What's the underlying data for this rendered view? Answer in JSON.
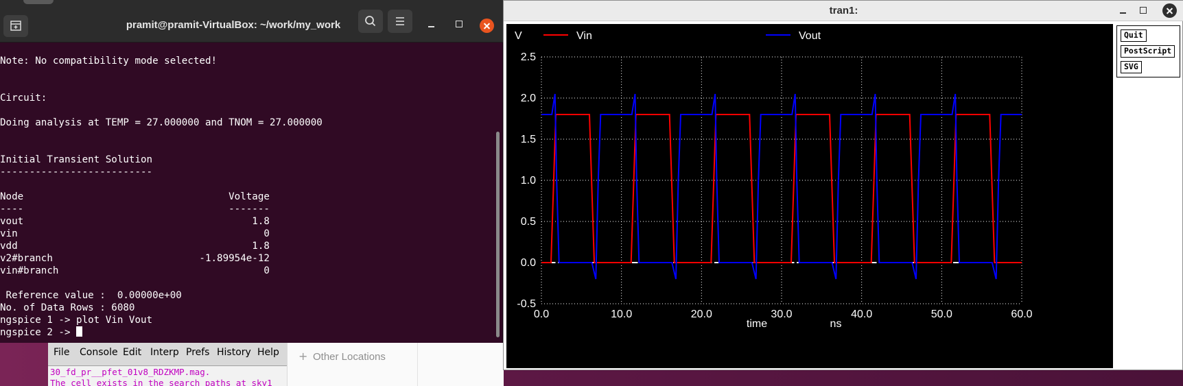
{
  "terminal": {
    "title": "pramit@pramit-VirtualBox: ~/work/my_work",
    "lines": [
      "Note: No compatibility mode selected!",
      "",
      "",
      "Circuit:",
      "",
      "Doing analysis at TEMP = 27.000000 and TNOM = 27.000000",
      "",
      "",
      "Initial Transient Solution",
      "--------------------------",
      "",
      "Node                                   Voltage",
      "----                                   -------",
      "vout                                       1.8",
      "vin                                          0",
      "vdd                                        1.8",
      "v2#branch                         -1.89954e-12",
      "vin#branch                                   0",
      "",
      " Reference value :  0.00000e+00",
      "No. of Data Rows : 6080",
      "ngspice 1 -> plot Vin Vout",
      "ngspice 2 -> "
    ]
  },
  "tkcon": {
    "menu": [
      "File",
      "Console",
      "Edit",
      "Interp",
      "Prefs",
      "History",
      "Help"
    ],
    "lines": [
      "30_fd_pr__pfet_01v8_RDZKMP.mag.",
      "The cell exists in the search paths at sky1"
    ]
  },
  "files": {
    "other_locations": "Other Locations"
  },
  "plot_window": {
    "title": "tran1:",
    "buttons": [
      "Quit",
      "PostScript",
      "SVG"
    ]
  },
  "chart_data": {
    "type": "line",
    "title": "",
    "ylabel": "V",
    "xlabel": "time",
    "xunit": "ns",
    "xlim": [
      0,
      60
    ],
    "ylim": [
      -0.5,
      2.5
    ],
    "xticks": [
      "0.0",
      "10.0",
      "20.0",
      "30.0",
      "40.0",
      "50.0",
      "60.0"
    ],
    "yticks": [
      "-0.5",
      "0.0",
      "0.5",
      "1.0",
      "1.5",
      "2.0",
      "2.5"
    ],
    "grid": true,
    "background": "#000000",
    "legend_placement": "top",
    "series": [
      {
        "name": "Vin",
        "color": "#ff0000",
        "x": [
          0,
          1.2,
          1.8,
          6,
          6.6,
          11.2,
          11.8,
          16,
          16.6,
          21.2,
          21.8,
          26,
          26.6,
          31.2,
          31.8,
          36,
          36.6,
          41.2,
          41.8,
          46,
          46.6,
          51.2,
          51.8,
          56,
          56.6,
          60
        ],
        "values": [
          0,
          0,
          1.8,
          1.8,
          0,
          0,
          1.8,
          1.8,
          0,
          0,
          1.8,
          1.8,
          0,
          0,
          1.8,
          1.8,
          0,
          0,
          1.8,
          1.8,
          0,
          0,
          1.8,
          1.8,
          0,
          0
        ]
      },
      {
        "name": "Vout",
        "color": "#0000ff",
        "x": [
          0,
          1.3,
          1.7,
          1.9,
          2.2,
          6.3,
          6.8,
          7.1,
          7.4,
          11.3,
          11.7,
          11.9,
          12.2,
          16.3,
          16.8,
          17.1,
          17.4,
          21.3,
          21.7,
          21.9,
          22.2,
          26.3,
          26.8,
          27.1,
          27.4,
          31.3,
          31.7,
          31.9,
          32.2,
          36.3,
          36.8,
          37.1,
          37.4,
          41.3,
          41.7,
          41.9,
          42.2,
          46.3,
          46.8,
          47.1,
          47.4,
          51.3,
          51.7,
          51.9,
          52.2,
          56.3,
          56.8,
          57.1,
          57.4,
          60
        ],
        "values": [
          1.8,
          1.8,
          2.05,
          1.0,
          0,
          0,
          -0.2,
          1.0,
          1.8,
          1.8,
          2.05,
          1.0,
          0,
          0,
          -0.2,
          1.0,
          1.8,
          1.8,
          2.05,
          1.0,
          0,
          0,
          -0.2,
          1.0,
          1.8,
          1.8,
          2.05,
          1.0,
          0,
          0,
          -0.2,
          1.0,
          1.8,
          1.8,
          2.05,
          1.0,
          0,
          0,
          -0.2,
          1.0,
          1.8,
          1.8,
          2.05,
          1.0,
          0,
          0,
          -0.2,
          1.0,
          1.8,
          1.8
        ]
      }
    ]
  }
}
